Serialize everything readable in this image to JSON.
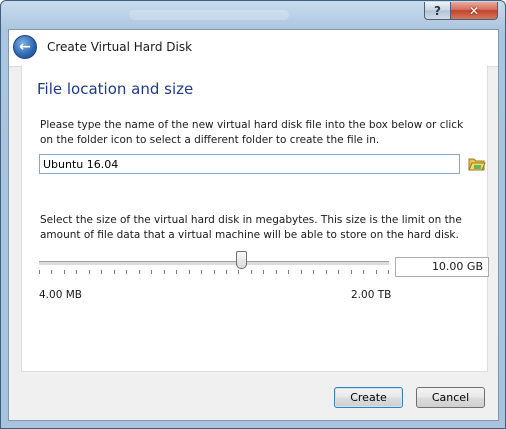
{
  "window": {
    "help_label": "?",
    "close_label": "✕"
  },
  "header": {
    "title": "Create Virtual Hard Disk",
    "back_icon": "back-arrow-icon"
  },
  "section": {
    "title": "File location and size"
  },
  "location": {
    "description": "Please type the name of the new virtual hard disk file into the box below or click on the folder icon to select a different folder to create the file in.",
    "value": "Ubuntu 16.04",
    "folder_icon": "folder-icon"
  },
  "size": {
    "description": "Select the size of the virtual hard disk in megabytes. This size is the limit on the amount of file data that a virtual machine will be able to store on the hard disk.",
    "value": "10.00 GB",
    "min_label": "4.00 MB",
    "max_label": "2.00 TB",
    "slider_fraction": 0.58
  },
  "buttons": {
    "create": "Create",
    "cancel": "Cancel"
  }
}
